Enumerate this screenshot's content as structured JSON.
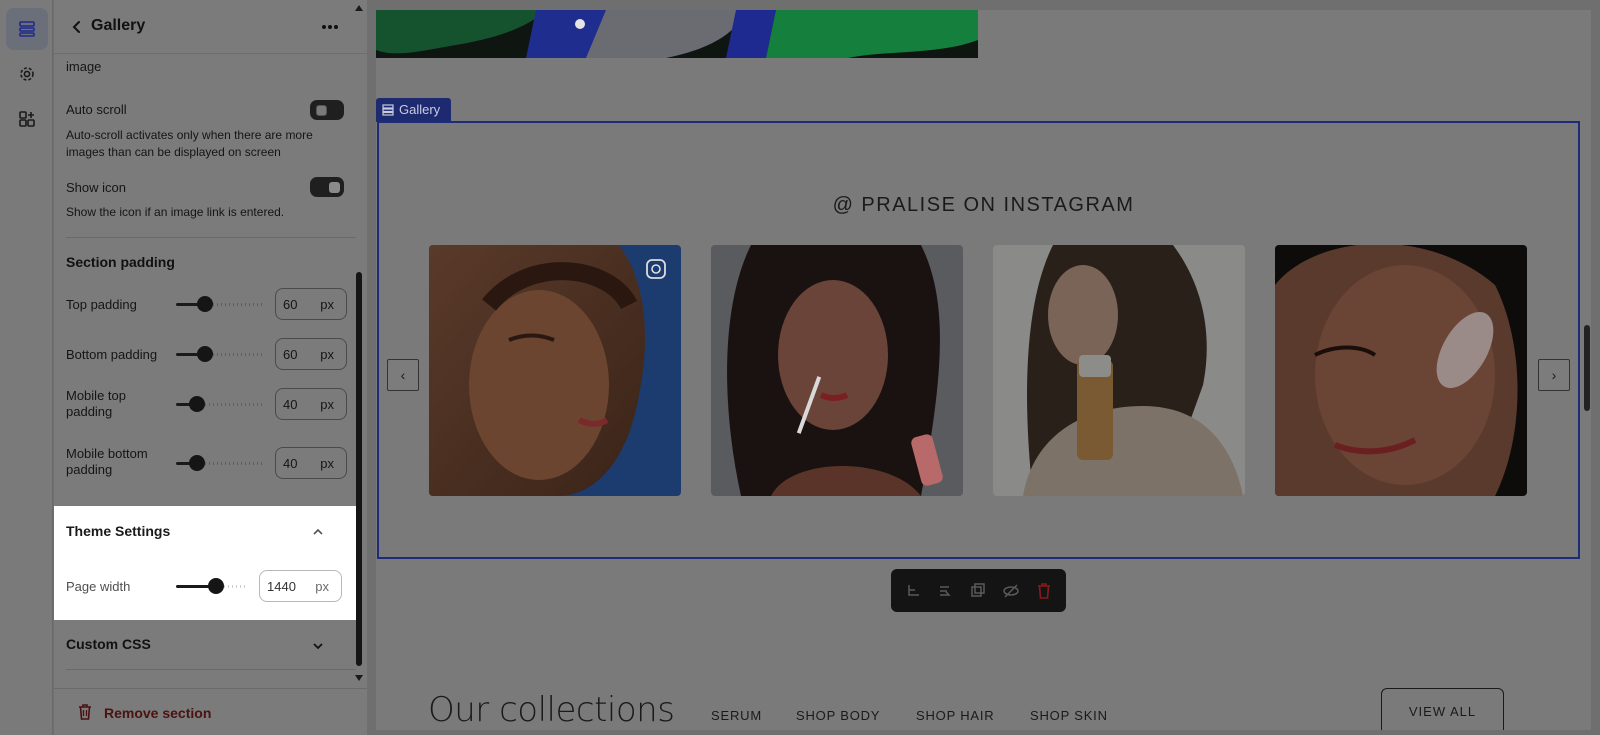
{
  "panel": {
    "title": "Gallery",
    "partial_label": "image",
    "auto_scroll": {
      "label": "Auto scroll",
      "description": "Auto-scroll activates only when there are more images than can be displayed on screen",
      "on": false
    },
    "show_icon": {
      "label": "Show icon",
      "description": "Show the icon if an image link is entered.",
      "on": true
    },
    "section_padding": {
      "heading": "Section padding",
      "rows": [
        {
          "label": "Top padding",
          "value": "60",
          "unit": "px",
          "fill": 0.33
        },
        {
          "label": "Bottom padding",
          "value": "60",
          "unit": "px",
          "fill": 0.33
        },
        {
          "label": "Mobile top padding",
          "value": "40",
          "unit": "px",
          "fill": 0.24
        },
        {
          "label": "Mobile bottom padding",
          "value": "40",
          "unit": "px",
          "fill": 0.24
        }
      ]
    },
    "theme_settings": {
      "heading": "Theme Settings",
      "page_width": {
        "label": "Page width",
        "value": "1440",
        "unit": "px",
        "fill": 0.55
      }
    },
    "custom_css": {
      "heading": "Custom CSS"
    },
    "remove_label": "Remove section"
  },
  "preview": {
    "gallery_tag": "Gallery",
    "instagram_title": "@ PRALISE ON INSTAGRAM",
    "nav_prev": "‹",
    "nav_next": "›",
    "collections": {
      "title": "Our collections",
      "tabs": [
        "SERUM",
        "SHOP BODY",
        "SHOP HAIR",
        "SHOP SKIN"
      ],
      "active_tab": "SERUM",
      "view_all": "VIEW ALL"
    }
  },
  "colors": {
    "accent": "#1e2a7a",
    "delete": "#c62828"
  }
}
